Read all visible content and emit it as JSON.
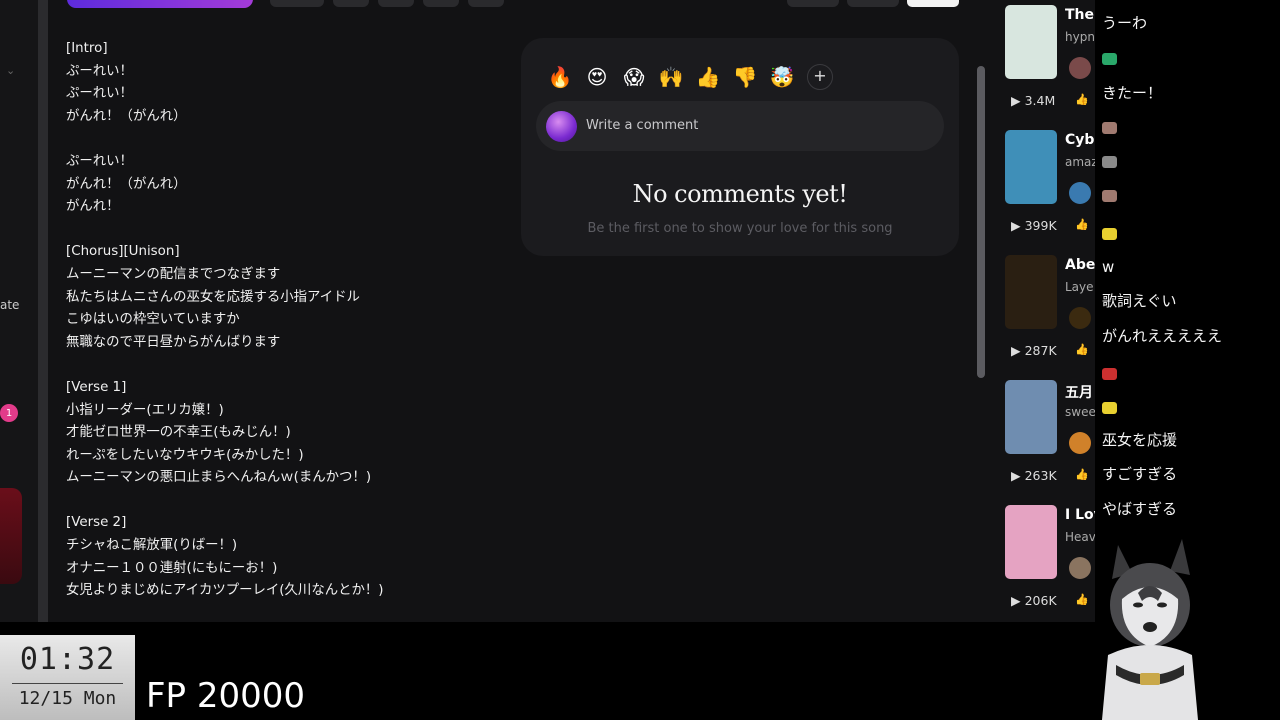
{
  "left_rail": {
    "rate_label": "ate",
    "badge": "1",
    "chevron": "⌄"
  },
  "lyrics": [
    "[Intro]",
    "ぷーれい！",
    "ぷーれい！",
    "がんれ！（がんれ）",
    "",
    "ぷーれい！",
    "がんれ！（がんれ）",
    "がんれ！",
    "",
    "[Chorus][Unison]",
    "ムーニーマンの配信までつなぎます",
    "私たちはムニさんの巫女を応援する小指アイドル",
    "こゆはいの枠空いていますか",
    "無職なので平日昼からがんばります",
    "",
    "[Verse 1]",
    "小指リーダー(エリカ嬢！)",
    "才能ゼロ世界一の不幸王(もみじん！)",
    "れーぷをしたいなウキウキ(みかした！)",
    "ムーニーマンの悪口止まらへんねんｗ(まんかつ！)",
    "",
    "[Verse 2]",
    "チシャねこ解放軍(りばー！)",
    "オナニー１００連射(にもにーお！)",
    "女児よりまじめにアイカツプーレイ(久川なんとか！)"
  ],
  "comments": {
    "reactions": [
      "🔥",
      "😍",
      "😱",
      "🙌",
      "👍",
      "👎",
      "🤯"
    ],
    "add_reaction": "+",
    "placeholder": "Write a comment",
    "empty_title": "No comments yet!",
    "empty_subtitle": "Be the first one to show your love for this song"
  },
  "songs": [
    {
      "title": "The",
      "artist": "hypn",
      "plays": "▶ 3.4M",
      "like": "👍",
      "thumb_color": "#d8e6df",
      "avatar_color": "#7a4a4a"
    },
    {
      "title": "Cyb",
      "artist": "amaz",
      "plays": "▶ 399K",
      "like": "👍",
      "thumb_color": "#3f8fb8",
      "avatar_color": "#3a7ab0"
    },
    {
      "title": "Abe",
      "artist": "Laye",
      "plays": "▶ 287K",
      "like": "👍",
      "thumb_color": "#2a1f12",
      "avatar_color": "#3b2a10"
    },
    {
      "title": "五月",
      "artist": "swee",
      "plays": "▶ 263K",
      "like": "👍",
      "thumb_color": "#6f8db0",
      "avatar_color": "#d0812a"
    },
    {
      "title": "I Lov",
      "artist": "Heav",
      "plays": "▶ 206K",
      "like": "👍",
      "thumb_color": "#e5a3c2",
      "avatar_color": "#8a7460"
    }
  ],
  "chat": [
    {
      "text": "うーわ"
    },
    {
      "icon": "#2aa86a"
    },
    {
      "text": "きたー！"
    },
    {
      "icon": "#a07a70"
    },
    {
      "icon": "#8a8a8a"
    },
    {
      "icon": "#a07a70"
    },
    {
      "icon": "#e8d030"
    },
    {
      "text": "w"
    },
    {
      "text": "歌詞えぐい"
    },
    {
      "text": "がんれえええええ"
    },
    {
      "icon": "#cc3030"
    },
    {
      "icon": "#e8d030"
    },
    {
      "text": "巫女を応援"
    },
    {
      "text": "すごすぎる"
    },
    {
      "text": "やばすぎる"
    }
  ],
  "clock": {
    "time": "01:32",
    "date": "12/15 Mon"
  },
  "fp_label": "FP 20000"
}
